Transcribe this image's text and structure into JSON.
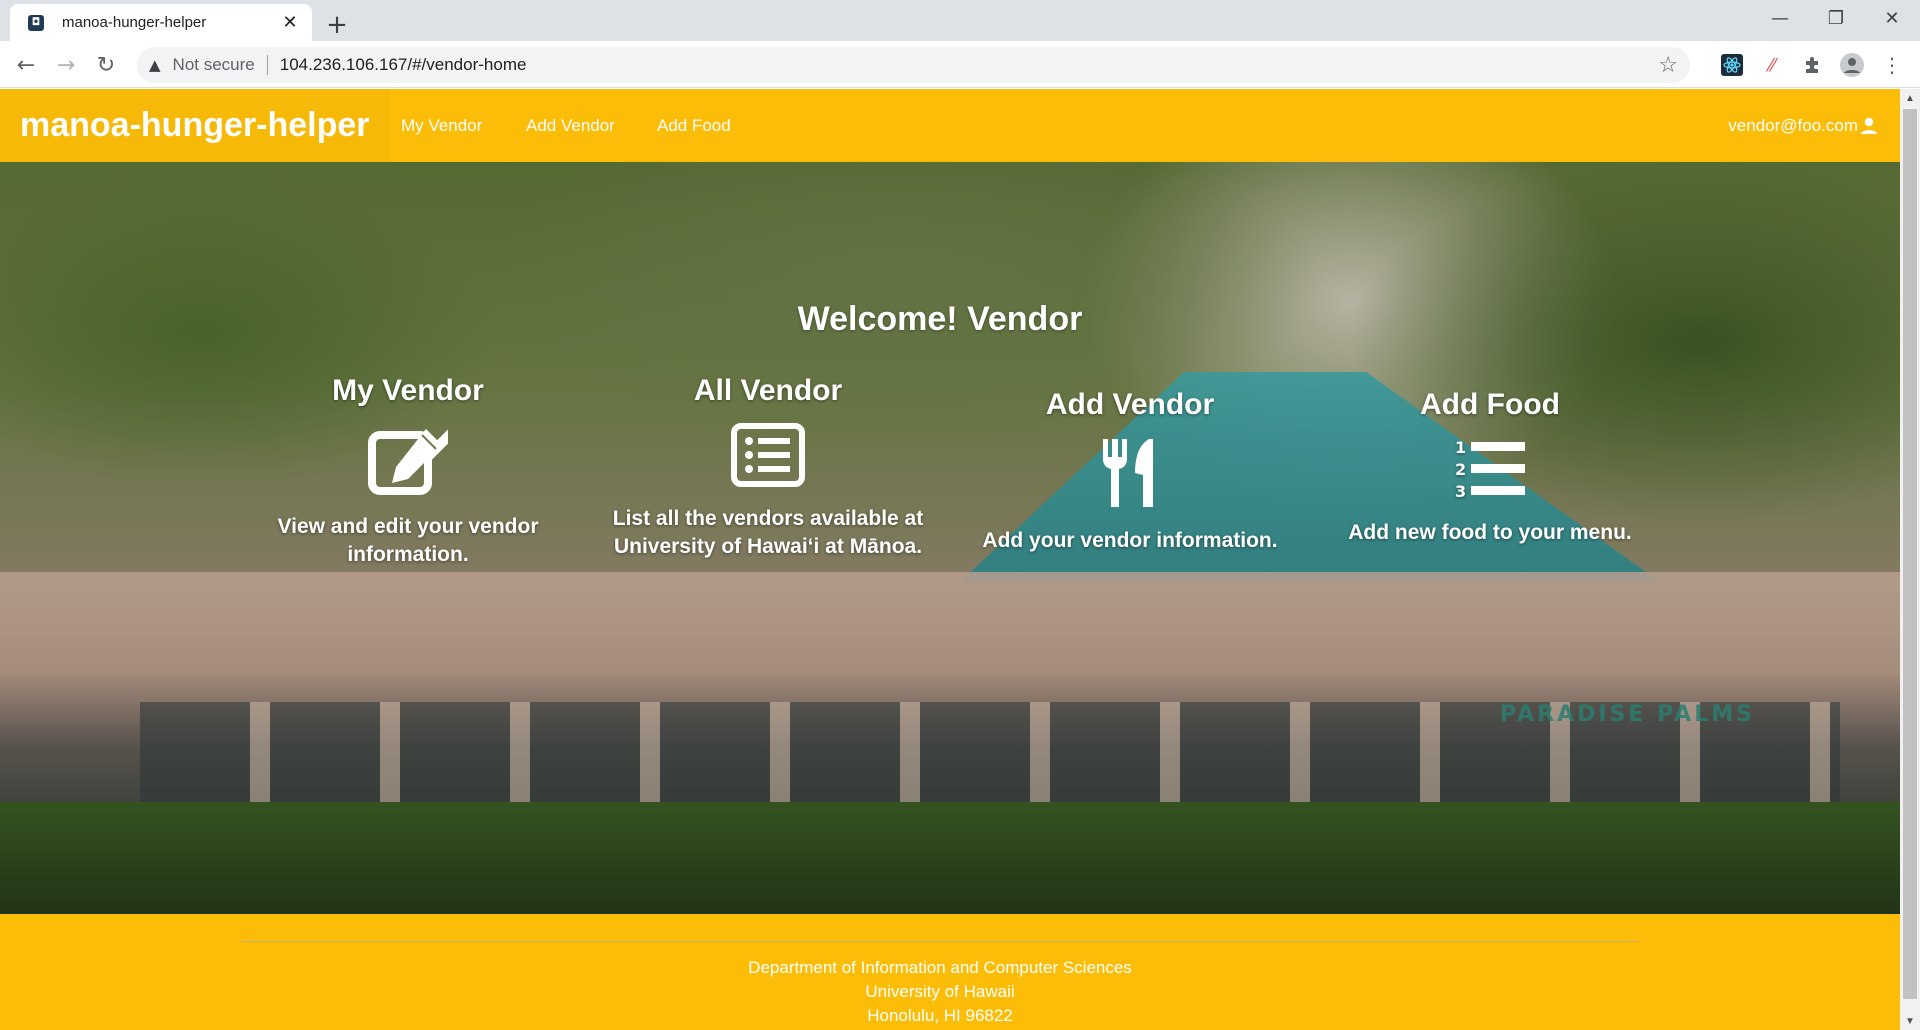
{
  "browser": {
    "tab_title": "manoa-hunger-helper",
    "tab_close": "✕",
    "new_tab": "+",
    "security_label": "Not secure",
    "url": "104.236.106.167/#/vendor-home"
  },
  "navbar": {
    "brand": "manoa-hunger-helper",
    "items": [
      "My Vendor",
      "Add Vendor",
      "Add Food"
    ],
    "user": "vendor@foo.com"
  },
  "hero": {
    "welcome": "Welcome! Vendor",
    "cards": [
      {
        "title": "My Vendor",
        "icon": "edit-icon",
        "description": "View and edit your vendor information."
      },
      {
        "title": "All Vendor",
        "icon": "list-alt-icon",
        "description": "List all the vendors available at University of Hawaiʻi at Mānoa."
      },
      {
        "title": "Add Vendor",
        "icon": "utensils-icon",
        "description": "Add your vendor information."
      },
      {
        "title": "Add Food",
        "icon": "numbered-list-icon",
        "description": "Add new food to your menu."
      }
    ],
    "sign_text": "PARADISE PALMS"
  },
  "footer": {
    "line1": "Department of Information and Computer Sciences",
    "line2": "University of Hawaii",
    "line3": "Honolulu, HI 96822"
  },
  "colors": {
    "navbar": "#fbbd08",
    "text": "#ffffff"
  }
}
